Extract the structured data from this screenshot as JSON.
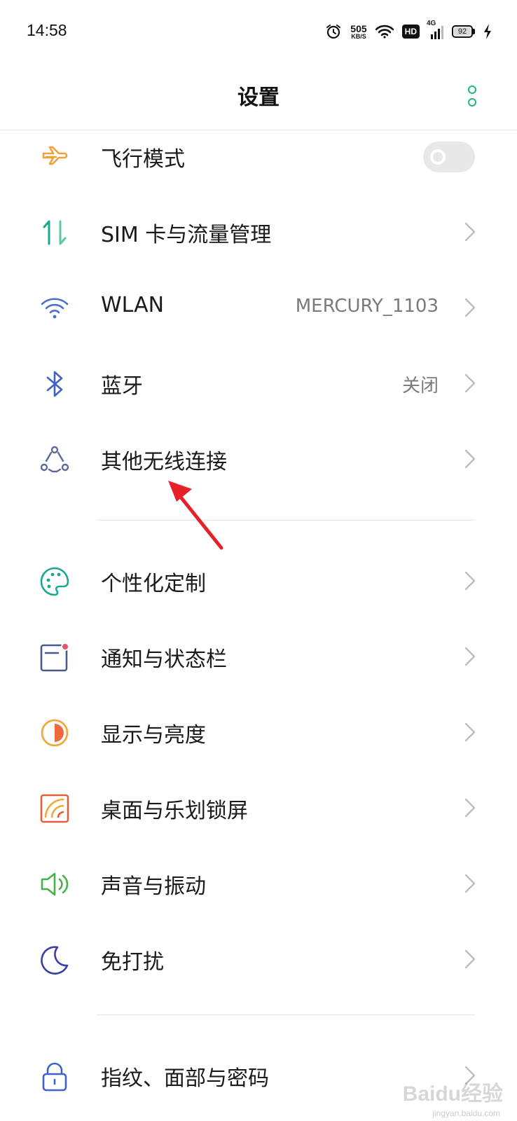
{
  "status_bar": {
    "time": "14:58",
    "net_speed": "505",
    "net_unit": "KB/S",
    "hd_label": "HD",
    "network_type": "4G",
    "battery_level": "92"
  },
  "header": {
    "title": "设置"
  },
  "items": [
    {
      "label": "飞行模式",
      "icon": "airplane-icon",
      "toggle": "off"
    },
    {
      "label": "SIM 卡与流量管理",
      "icon": "data-transfer-icon"
    },
    {
      "label": "WLAN",
      "value": "MERCURY_1103",
      "icon": "wifi-icon"
    },
    {
      "label": "蓝牙",
      "value": "关闭",
      "icon": "bluetooth-icon"
    },
    {
      "label": "其他无线连接",
      "icon": "wireless-connections-icon"
    },
    {
      "label": "个性化定制",
      "icon": "palette-icon"
    },
    {
      "label": "通知与状态栏",
      "icon": "notification-icon"
    },
    {
      "label": "显示与亮度",
      "icon": "brightness-icon"
    },
    {
      "label": "桌面与乐划锁屏",
      "icon": "wallpaper-icon"
    },
    {
      "label": "声音与振动",
      "icon": "speaker-icon"
    },
    {
      "label": "免打扰",
      "icon": "moon-icon"
    },
    {
      "label": "指纹、面部与密码",
      "icon": "lock-icon"
    }
  ],
  "watermark": {
    "text": "Baidu经验",
    "sub": "jingyan.baidu.com"
  },
  "colors": {
    "accent": "#1fb878",
    "arrow": "#e8202a"
  }
}
